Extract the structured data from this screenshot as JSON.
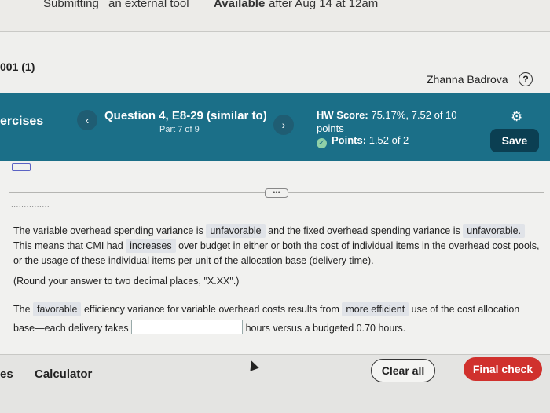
{
  "top_strip": {
    "submitting_text": "Submitting",
    "external_tool": "an external tool",
    "available_label": "Available",
    "available_after": "after Aug 14 at 12am"
  },
  "course": {
    "name": "001 (1)",
    "user": "Zhanna Badrova",
    "help_glyph": "?"
  },
  "header": {
    "exercises_label": "ercises",
    "prev_glyph": "‹",
    "next_glyph": "›",
    "question_title": "Question 4, E8-29 (similar to)",
    "part": "Part 7 of 9",
    "hw_score_label": "HW Score:",
    "hw_score_value": "75.17%, 7.52 of 10",
    "hw_score_unit": "points",
    "points_label": "Points:",
    "points_value": "1.52 of 2",
    "gear_glyph": "⚙",
    "save_label": "Save"
  },
  "question": {
    "faded_text": "...............",
    "p1_a": "The variable overhead spending variance is",
    "p1_ans1": "unfavorable",
    "p1_b": "and the fixed overhead spending variance is",
    "p1_ans2": "unfavorable.",
    "p1_c": "This means that CMI had",
    "p1_ans3": "increases",
    "p1_d": "over budget in either or both the cost of individual items in the overhead cost pools, or the usage of these individual items per unit of the allocation base (delivery time).",
    "round_note": "(Round your answer to two decimal places, \"X.XX\".)",
    "p2_a": "The",
    "p2_ans1": "favorable",
    "p2_b": "efficiency variance for variable overhead costs results from",
    "p2_ans2": "more efficient",
    "p2_c": "use of the cost allocation base—each delivery takes",
    "p2_d": "hours versus a budgeted 0.70 hours.",
    "hours_input_value": ""
  },
  "footer": {
    "es_label": "es",
    "calculator_label": "Calculator",
    "clear_all_label": "Clear all",
    "final_check_label": "Final check"
  },
  "colors": {
    "header_bar": "#1b6f88",
    "save_button": "#0b3f52",
    "final_check": "#d0312d"
  }
}
